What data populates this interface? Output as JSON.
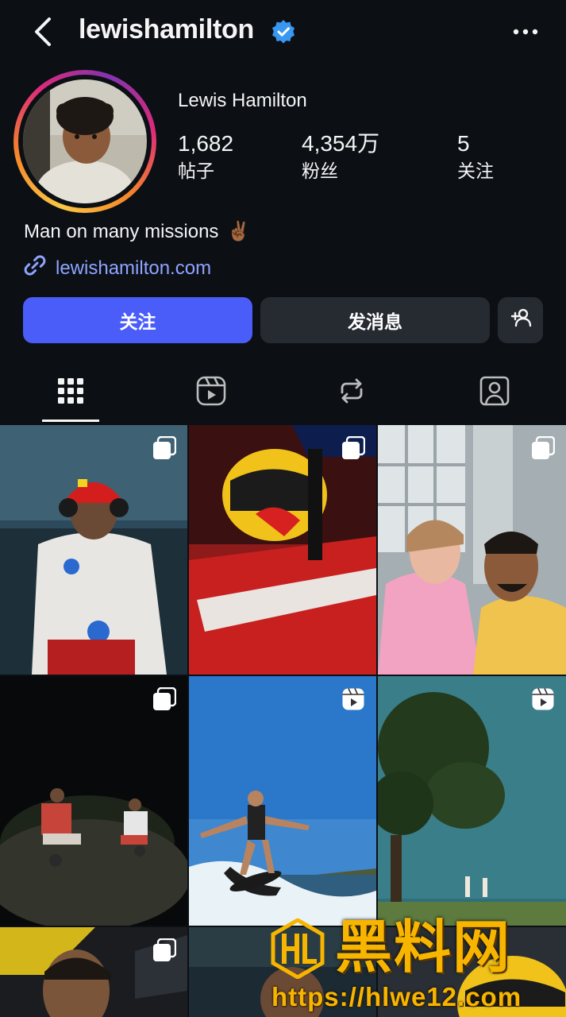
{
  "header": {
    "username": "lewishamilton"
  },
  "profile": {
    "full_name": "Lewis Hamilton",
    "stats": [
      {
        "value": "1,682",
        "label": "帖子"
      },
      {
        "value": "4,354万",
        "label": "粉丝"
      },
      {
        "value": "5",
        "label": "关注"
      }
    ],
    "bio": "Man on many missions",
    "bio_emoji": "✌🏾",
    "link": "lewishamilton.com"
  },
  "actions": {
    "follow": "关注",
    "message": "发消息"
  },
  "tabs": [
    "grid-icon",
    "reels-icon",
    "reposts-icon",
    "tagged-icon"
  ],
  "posts": [
    {
      "subject": "driver in Ferrari race suit",
      "badge": "carousel-icon"
    },
    {
      "subject": "yellow helmet in cockpit",
      "badge": "carousel-icon"
    },
    {
      "subject": "selfie with child",
      "badge": "carousel-icon"
    },
    {
      "subject": "night motorbike ride",
      "badge": "carousel-icon"
    },
    {
      "subject": "wakesurfing",
      "badge": "reel-icon"
    },
    {
      "subject": "tree on golf course",
      "badge": "reel-icon"
    },
    {
      "subject": "portrait",
      "badge": "carousel-icon"
    },
    {
      "subject": "portrait",
      "badge": "none"
    },
    {
      "subject": "helmet",
      "badge": "none"
    }
  ],
  "watermark": {
    "title": "黑料网",
    "url": "https://hlwe12.com"
  },
  "colors": {
    "background": "#0c0f14",
    "follow_button": "#4a5df9",
    "secondary_button": "#262a31",
    "link": "#8fa4ff",
    "verified": "#3897f0"
  }
}
